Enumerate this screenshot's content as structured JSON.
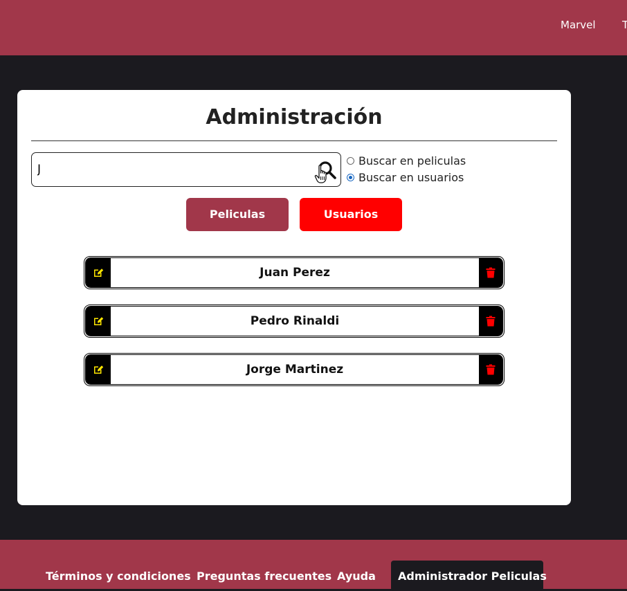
{
  "header": {
    "nav_items": [
      "Marvel",
      "T"
    ],
    "background": "#a1374a"
  },
  "panel": {
    "title": "Administración",
    "search": {
      "value": "J",
      "icon": "search-icon"
    },
    "radios": [
      {
        "label": "Buscar en peliculas",
        "checked": false
      },
      {
        "label": "Buscar en usuarios",
        "checked": true
      }
    ],
    "buttons": {
      "peliculas": "Peliculas",
      "usuarios": "Usuarios"
    },
    "users": [
      {
        "name": "Juan Perez"
      },
      {
        "name": "Pedro Rinaldi"
      },
      {
        "name": "Jorge Martinez"
      }
    ]
  },
  "footer": {
    "links": [
      "Términos y condiciones",
      "Preguntas frecuentes",
      "Ayuda"
    ],
    "active": "Administrador Peliculas"
  },
  "colors": {
    "brand": "#a1374a",
    "accent_red": "#ff0000",
    "dark": "#1b1a1f",
    "edit_icon": "#ffe600",
    "delete_icon": "#ff0000"
  }
}
